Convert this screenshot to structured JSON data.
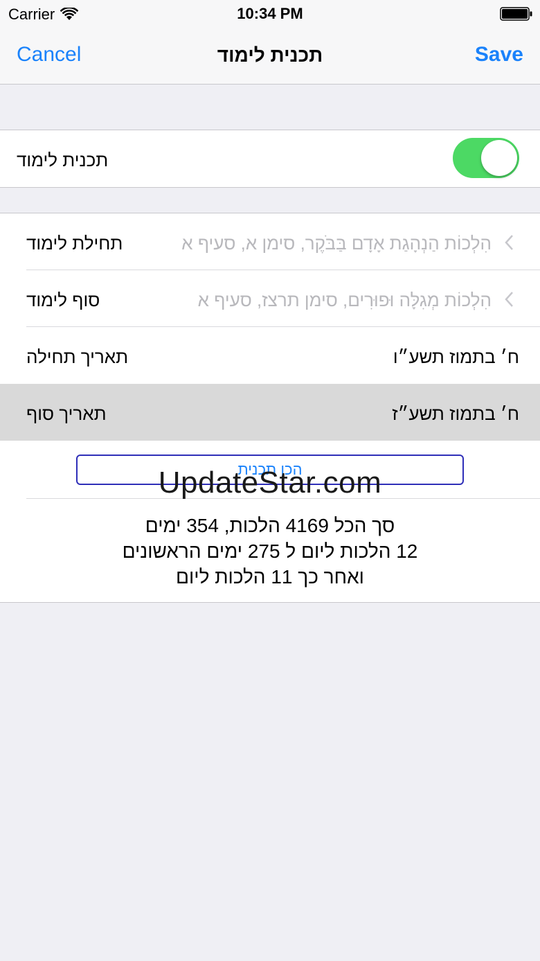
{
  "status_bar": {
    "carrier": "Carrier",
    "time": "10:34 PM"
  },
  "nav": {
    "cancel": "Cancel",
    "title": "תכנית לימוד",
    "save": "Save"
  },
  "toggle": {
    "label": "תכנית לימוד",
    "on": true,
    "color": "#4cd964"
  },
  "rows": [
    {
      "label": "תחילת לימוד",
      "value": "הִלְכוֹת הַנְהָגַת אָדָם בַּבֹּקֶר, סימן א, סעיף א"
    },
    {
      "label": "סוף לימוד",
      "value": "הִלְכוֹת מְגִלָּה וּפוּרִים, סימן תרצז, סעיף א"
    },
    {
      "label": "תאריך תחילה",
      "value": "ח׳ בתמוז תשע״ו"
    },
    {
      "label": "תאריך סוף",
      "value": "ח׳ בתמוז תשע״ז"
    }
  ],
  "plan_button": "הכן תכנית",
  "summary": {
    "line1": "סך הכל 4169 הלכות, 354 ימים",
    "line2": "12 הלכות ליום  ל 275 ימים הראשונים",
    "line3": "ואחר כך 11 הלכות ליום"
  },
  "watermark": "UpdateStar.com",
  "colors": {
    "accent": "#1a82fb",
    "background": "#efeff4",
    "highlight_row": "#d9d9d9"
  }
}
